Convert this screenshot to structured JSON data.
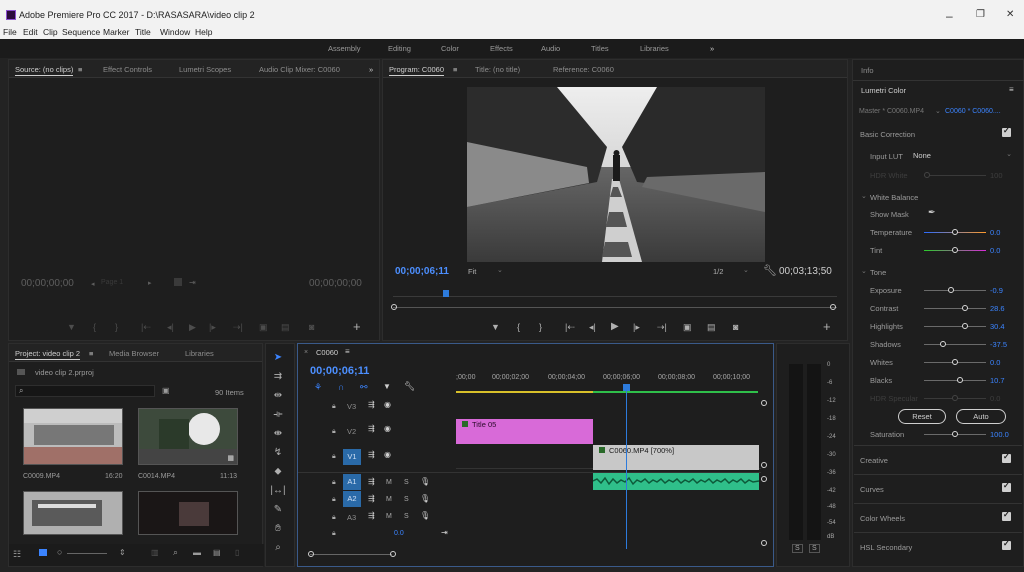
{
  "window": {
    "title": "Adobe Premiere Pro CC 2017 - D:\\RASASARA\\video clip 2",
    "minimize": "–",
    "maximize": "❐",
    "close": "✕"
  },
  "menu": [
    "File",
    "Edit",
    "Clip",
    "Sequence",
    "Marker",
    "Title",
    "Window",
    "Help"
  ],
  "workspaces": [
    "Assembly",
    "Editing",
    "Color",
    "Effects",
    "Audio",
    "Titles",
    "Libraries",
    "»"
  ],
  "source_panel": {
    "tabs": [
      "Source: (no clips)",
      "Effect Controls",
      "Lumetri Scopes",
      "Audio Clip Mixer: C0060",
      "»"
    ],
    "timecode_left": "00;00;00;00",
    "page_label": "Page 1",
    "timecode_right": "00;00;00;00"
  },
  "program_panel": {
    "tabs": [
      "Program: C0060",
      "Title: (no title)",
      "Reference: C0060"
    ],
    "timecode": "00;00;06;11",
    "fit": "Fit",
    "resolution": "1/2",
    "duration": "00;03;13;50"
  },
  "project_panel": {
    "tabs": [
      "Project: video clip 2",
      "Media Browser",
      "Libraries"
    ],
    "project_file": "video clip 2.prproj",
    "search_placeholder": "",
    "items_count": "90 Items",
    "thumbs": [
      {
        "name": "C0009.MP4",
        "duration": "16:20"
      },
      {
        "name": "C0014.MP4",
        "duration": "11:13"
      },
      {
        "name": "",
        "duration": ""
      },
      {
        "name": "",
        "duration": ""
      }
    ]
  },
  "timeline": {
    "tab": "C0060",
    "timecode": "00;00;06;11",
    "ruler": [
      ";00;00",
      "00;00;02;00",
      "00;00;04;00",
      "00;00;06;00",
      "00;00;08;00",
      "00;00;10;00"
    ],
    "video_tracks": [
      "V3",
      "V2",
      "V1"
    ],
    "audio_tracks": [
      "A1",
      "A2",
      "A3"
    ],
    "master_val": "0.0",
    "clips": {
      "title": "Title 05",
      "video": "C0060.MP4 [700%]"
    }
  },
  "meter": {
    "scale": [
      "0",
      "-6",
      "-12",
      "-18",
      "-24",
      "-30",
      "-36",
      "-42",
      "-48",
      "-54",
      "dB"
    ],
    "solo": [
      "S",
      "S"
    ]
  },
  "lumetri": {
    "info_tab": "Info",
    "title": "Lumetri Color",
    "master_label": "Master * C0060.MP4",
    "clip_label": "C0060 * C0060....",
    "basic_correction": "Basic Correction",
    "input_lut_label": "Input LUT",
    "input_lut_value": "None",
    "hdr_white": "HDR White",
    "hdr_white_value": "100",
    "white_balance": "White Balance",
    "show_mask": "Show Mask",
    "temperature": {
      "label": "Temperature",
      "value": "0.0"
    },
    "tint": {
      "label": "Tint",
      "value": "0.0"
    },
    "tone": "Tone",
    "exposure": {
      "label": "Exposure",
      "value": "-0.9"
    },
    "contrast": {
      "label": "Contrast",
      "value": "28.6"
    },
    "highlights": {
      "label": "Highlights",
      "value": "30.4"
    },
    "shadows": {
      "label": "Shadows",
      "value": "-37.5"
    },
    "whites": {
      "label": "Whites",
      "value": "0.0"
    },
    "blacks": {
      "label": "Blacks",
      "value": "10.7"
    },
    "hdr_specular": {
      "label": "HDR Specular",
      "value": "0.0"
    },
    "reset": "Reset",
    "auto": "Auto",
    "saturation": {
      "label": "Saturation",
      "value": "100.0"
    },
    "sections": [
      "Creative",
      "Curves",
      "Color Wheels",
      "HSL Secondary"
    ]
  },
  "colors": {
    "accent_blue": "#3b84ff",
    "clip_title": "#d86ad8",
    "clip_video": "#c8c8c8",
    "clip_audio": "#2fbf8a",
    "playhead": "#2d7bdc"
  }
}
